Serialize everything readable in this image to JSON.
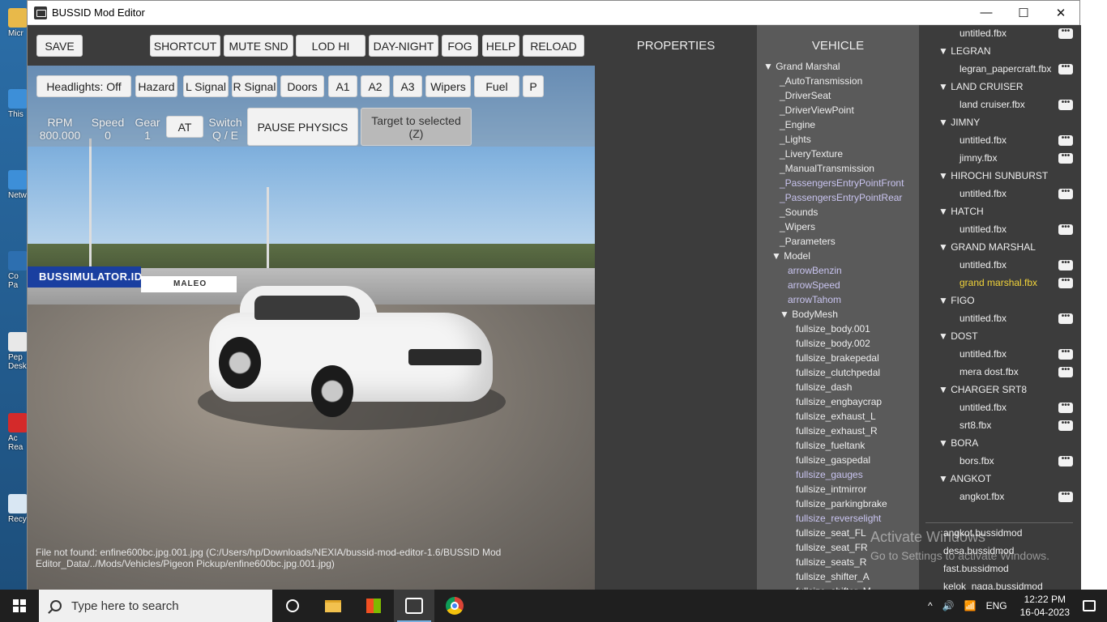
{
  "window": {
    "title": "BUSSID Mod Editor",
    "minimize": "—",
    "maximize": "☐",
    "close": "✕"
  },
  "desktop_icons": [
    {
      "label": "Micr",
      "color": "#e8b94a"
    },
    {
      "label": "This",
      "color": "#3d8fd8"
    },
    {
      "label": "Netw",
      "color": "#3d8fd8"
    },
    {
      "label": "Co\nPa",
      "color": "#2d6fb0"
    },
    {
      "label": "Pep\nDesk",
      "color": "#e8e8e8"
    },
    {
      "label": "Ac\nRea",
      "color": "#d42a2a"
    },
    {
      "label": "Recy",
      "color": "#d9e7f3"
    }
  ],
  "toolbar": {
    "save": "SAVE",
    "shortcut": "SHORTCUT",
    "mute": "MUTE SND",
    "lod": "LOD HI",
    "daynight": "DAY-NIGHT",
    "fog": "FOG",
    "help": "HELP",
    "reload": "RELOAD"
  },
  "controls": {
    "headlights": "Headlights: Off",
    "hazard": "Hazard",
    "lsignal": "L Signal",
    "rsignal": "R Signal",
    "doors": "Doors",
    "a1": "A1",
    "a2": "A2",
    "a3": "A3",
    "wipers": "Wipers",
    "fuel": "Fuel",
    "p": "P"
  },
  "gauges": {
    "rpm_label": "RPM",
    "rpm_value": "800.000",
    "speed_label": "Speed",
    "speed_value": "0",
    "gear_label": "Gear",
    "gear_value": "1",
    "at": "AT",
    "switch_label": "Switch",
    "switch_value": "Q / E",
    "pause": "PAUSE PHYSICS",
    "target1": "Target to selected",
    "target2": "(Z)"
  },
  "scene": {
    "banner": "BUSSIMULATOR.ID",
    "banner2": "MALEO"
  },
  "error_text": "File not found: enfine600bc.jpg.001.jpg (C:/Users/hp/Downloads/NEXIA/bussid-mod-editor-1.6/BUSSID Mod Editor_Data/../Mods/Vehicles/Pigeon Pickup/enfine600bc.jpg.001.jpg)",
  "properties": {
    "heading": "PROPERTIES"
  },
  "vehicle": {
    "heading": "VEHICLE",
    "tree": [
      {
        "text": "▼ Grand Marshal",
        "indent": 0,
        "hl": false
      },
      {
        "text": "_AutoTransmission",
        "indent": 2,
        "hl": false
      },
      {
        "text": "_DriverSeat",
        "indent": 2,
        "hl": false
      },
      {
        "text": "_DriverViewPoint",
        "indent": 2,
        "hl": false
      },
      {
        "text": "_Engine",
        "indent": 2,
        "hl": false
      },
      {
        "text": "_Lights",
        "indent": 2,
        "hl": false
      },
      {
        "text": "_LiveryTexture",
        "indent": 2,
        "hl": false
      },
      {
        "text": "_ManualTransmission",
        "indent": 2,
        "hl": false
      },
      {
        "text": "_PassengersEntryPointFront",
        "indent": 2,
        "hl": true
      },
      {
        "text": "_PassengersEntryPointRear",
        "indent": 2,
        "hl": true
      },
      {
        "text": "_Sounds",
        "indent": 2,
        "hl": false
      },
      {
        "text": "_Wipers",
        "indent": 2,
        "hl": false
      },
      {
        "text": "_Parameters",
        "indent": 2,
        "hl": false
      },
      {
        "text": "▼ Model",
        "indent": 1,
        "hl": false
      },
      {
        "text": "arrowBenzin",
        "indent": 3,
        "hl": true
      },
      {
        "text": "arrowSpeed",
        "indent": 3,
        "hl": true
      },
      {
        "text": "arrowTahom",
        "indent": 3,
        "hl": true
      },
      {
        "text": "▼ BodyMesh",
        "indent": 2,
        "hl": false
      },
      {
        "text": "fullsize_body.001",
        "indent": 4,
        "hl": false
      },
      {
        "text": "fullsize_body.002",
        "indent": 4,
        "hl": false
      },
      {
        "text": "fullsize_brakepedal",
        "indent": 4,
        "hl": false
      },
      {
        "text": "fullsize_clutchpedal",
        "indent": 4,
        "hl": false
      },
      {
        "text": "fullsize_dash",
        "indent": 4,
        "hl": false
      },
      {
        "text": "fullsize_engbaycrap",
        "indent": 4,
        "hl": false
      },
      {
        "text": "fullsize_exhaust_L",
        "indent": 4,
        "hl": false
      },
      {
        "text": "fullsize_exhaust_R",
        "indent": 4,
        "hl": false
      },
      {
        "text": "fullsize_fueltank",
        "indent": 4,
        "hl": false
      },
      {
        "text": "fullsize_gaspedal",
        "indent": 4,
        "hl": false
      },
      {
        "text": "fullsize_gauges",
        "indent": 4,
        "hl": true
      },
      {
        "text": "fullsize_intmirror",
        "indent": 4,
        "hl": false
      },
      {
        "text": "fullsize_parkingbrake",
        "indent": 4,
        "hl": false
      },
      {
        "text": "fullsize_reverselight",
        "indent": 4,
        "hl": true
      },
      {
        "text": "fullsize_seat_FL",
        "indent": 4,
        "hl": false
      },
      {
        "text": "fullsize_seat_FR",
        "indent": 4,
        "hl": false
      },
      {
        "text": "fullsize_seats_R",
        "indent": 4,
        "hl": false
      },
      {
        "text": "fullsize_shifter_A",
        "indent": 4,
        "hl": false
      },
      {
        "text": "fullsize_shifter_M",
        "indent": 4,
        "hl": false
      }
    ]
  },
  "mods": {
    "items": [
      {
        "text": "untitled.fbx",
        "type": "file",
        "dots": true,
        "hl": false
      },
      {
        "text": "▼  LEGRAN",
        "type": "group"
      },
      {
        "text": "legran_papercraft.fbx",
        "type": "file",
        "dots": true,
        "hl": false
      },
      {
        "text": "▼  LAND CRUISER",
        "type": "group"
      },
      {
        "text": "land cruiser.fbx",
        "type": "file",
        "dots": true,
        "hl": false
      },
      {
        "text": "▼  JIMNY",
        "type": "group"
      },
      {
        "text": "untitled.fbx",
        "type": "file",
        "dots": true,
        "hl": false
      },
      {
        "text": "jimny.fbx",
        "type": "file",
        "dots": true,
        "hl": false
      },
      {
        "text": "▼  HIROCHI SUNBURST",
        "type": "group"
      },
      {
        "text": "untitled.fbx",
        "type": "file",
        "dots": true,
        "hl": false
      },
      {
        "text": "▼  HATCH",
        "type": "group"
      },
      {
        "text": "untitled.fbx",
        "type": "file",
        "dots": true,
        "hl": false
      },
      {
        "text": "▼  GRAND MARSHAL",
        "type": "group"
      },
      {
        "text": "untitled.fbx",
        "type": "file",
        "dots": true,
        "hl": false
      },
      {
        "text": "grand marshal.fbx",
        "type": "file",
        "dots": true,
        "hl": true
      },
      {
        "text": "▼  FIGO",
        "type": "group"
      },
      {
        "text": "untitled.fbx",
        "type": "file",
        "dots": true,
        "hl": false
      },
      {
        "text": "▼  DOST",
        "type": "group"
      },
      {
        "text": "untitled.fbx",
        "type": "file",
        "dots": true,
        "hl": false
      },
      {
        "text": "mera dost.fbx",
        "type": "file",
        "dots": true,
        "hl": false
      },
      {
        "text": "▼  CHARGER SRT8",
        "type": "group"
      },
      {
        "text": "untitled.fbx",
        "type": "file",
        "dots": true,
        "hl": false
      },
      {
        "text": "srt8.fbx",
        "type": "file",
        "dots": true,
        "hl": false
      },
      {
        "text": "▼  BORA",
        "type": "group"
      },
      {
        "text": "bors.fbx",
        "type": "file",
        "dots": true,
        "hl": false
      },
      {
        "text": "▼  ANGKOT",
        "type": "group"
      },
      {
        "text": "angkot.fbx",
        "type": "file",
        "dots": true,
        "hl": false
      }
    ],
    "dots_label": "•••",
    "files": [
      "angkot.bussidmod",
      "desa.bussidmod",
      "fast.bussidmod",
      "kelok_naga.bussidmod"
    ]
  },
  "watermark": {
    "line1": "Activate Windows",
    "line2": "Go to Settings to activate Windows."
  },
  "taskbar": {
    "search_placeholder": "Type here to search",
    "tray_chevron": "^",
    "volume": "🔊",
    "wifi": "📶",
    "lang": "ENG",
    "time": "12:22 PM",
    "date": "16-04-2023"
  }
}
